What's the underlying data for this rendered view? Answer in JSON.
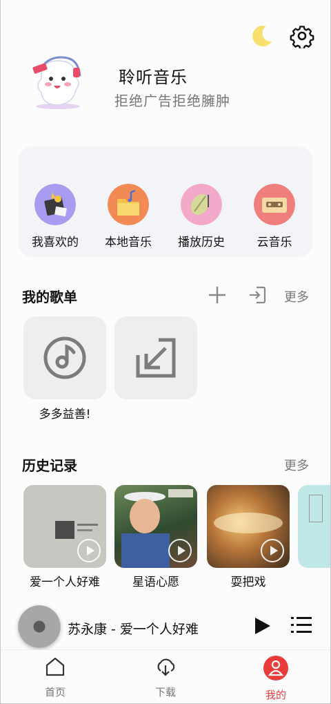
{
  "app": {
    "title": "聆听音乐",
    "subtitle": "拒绝广告拒绝臃肿"
  },
  "top_icons": [
    "moon-icon",
    "gear-icon"
  ],
  "quick_access": [
    {
      "label": "我喜欢的",
      "icon": "favorites-icon",
      "color": "#a79cf0"
    },
    {
      "label": "本地音乐",
      "icon": "local-music-icon",
      "color": "#f28a55"
    },
    {
      "label": "播放历史",
      "icon": "history-icon",
      "color": "#f2a9c9"
    },
    {
      "label": "云音乐",
      "icon": "cloud-music-icon",
      "color": "#f07f7c"
    }
  ],
  "playlists": {
    "title": "我的歌单",
    "more": "更多",
    "items": [
      {
        "label": "多多益善!"
      },
      {
        "label": ""
      }
    ]
  },
  "history": {
    "title": "历史记录",
    "more": "更多",
    "items": [
      {
        "label": "爱一个人好难"
      },
      {
        "label": "星语心愿"
      },
      {
        "label": "耍把戏"
      }
    ]
  },
  "mini_player": {
    "now_playing": "苏永康 - 爱一个人好难"
  },
  "tabs": [
    {
      "label": "首页",
      "icon": "home-icon"
    },
    {
      "label": "下载",
      "icon": "download-icon"
    },
    {
      "label": "我的",
      "icon": "profile-icon",
      "active": true
    }
  ],
  "colors": {
    "accent": "#ec3b3b",
    "card_bg": "#f3f4f8",
    "moon": "#f7e06e"
  }
}
